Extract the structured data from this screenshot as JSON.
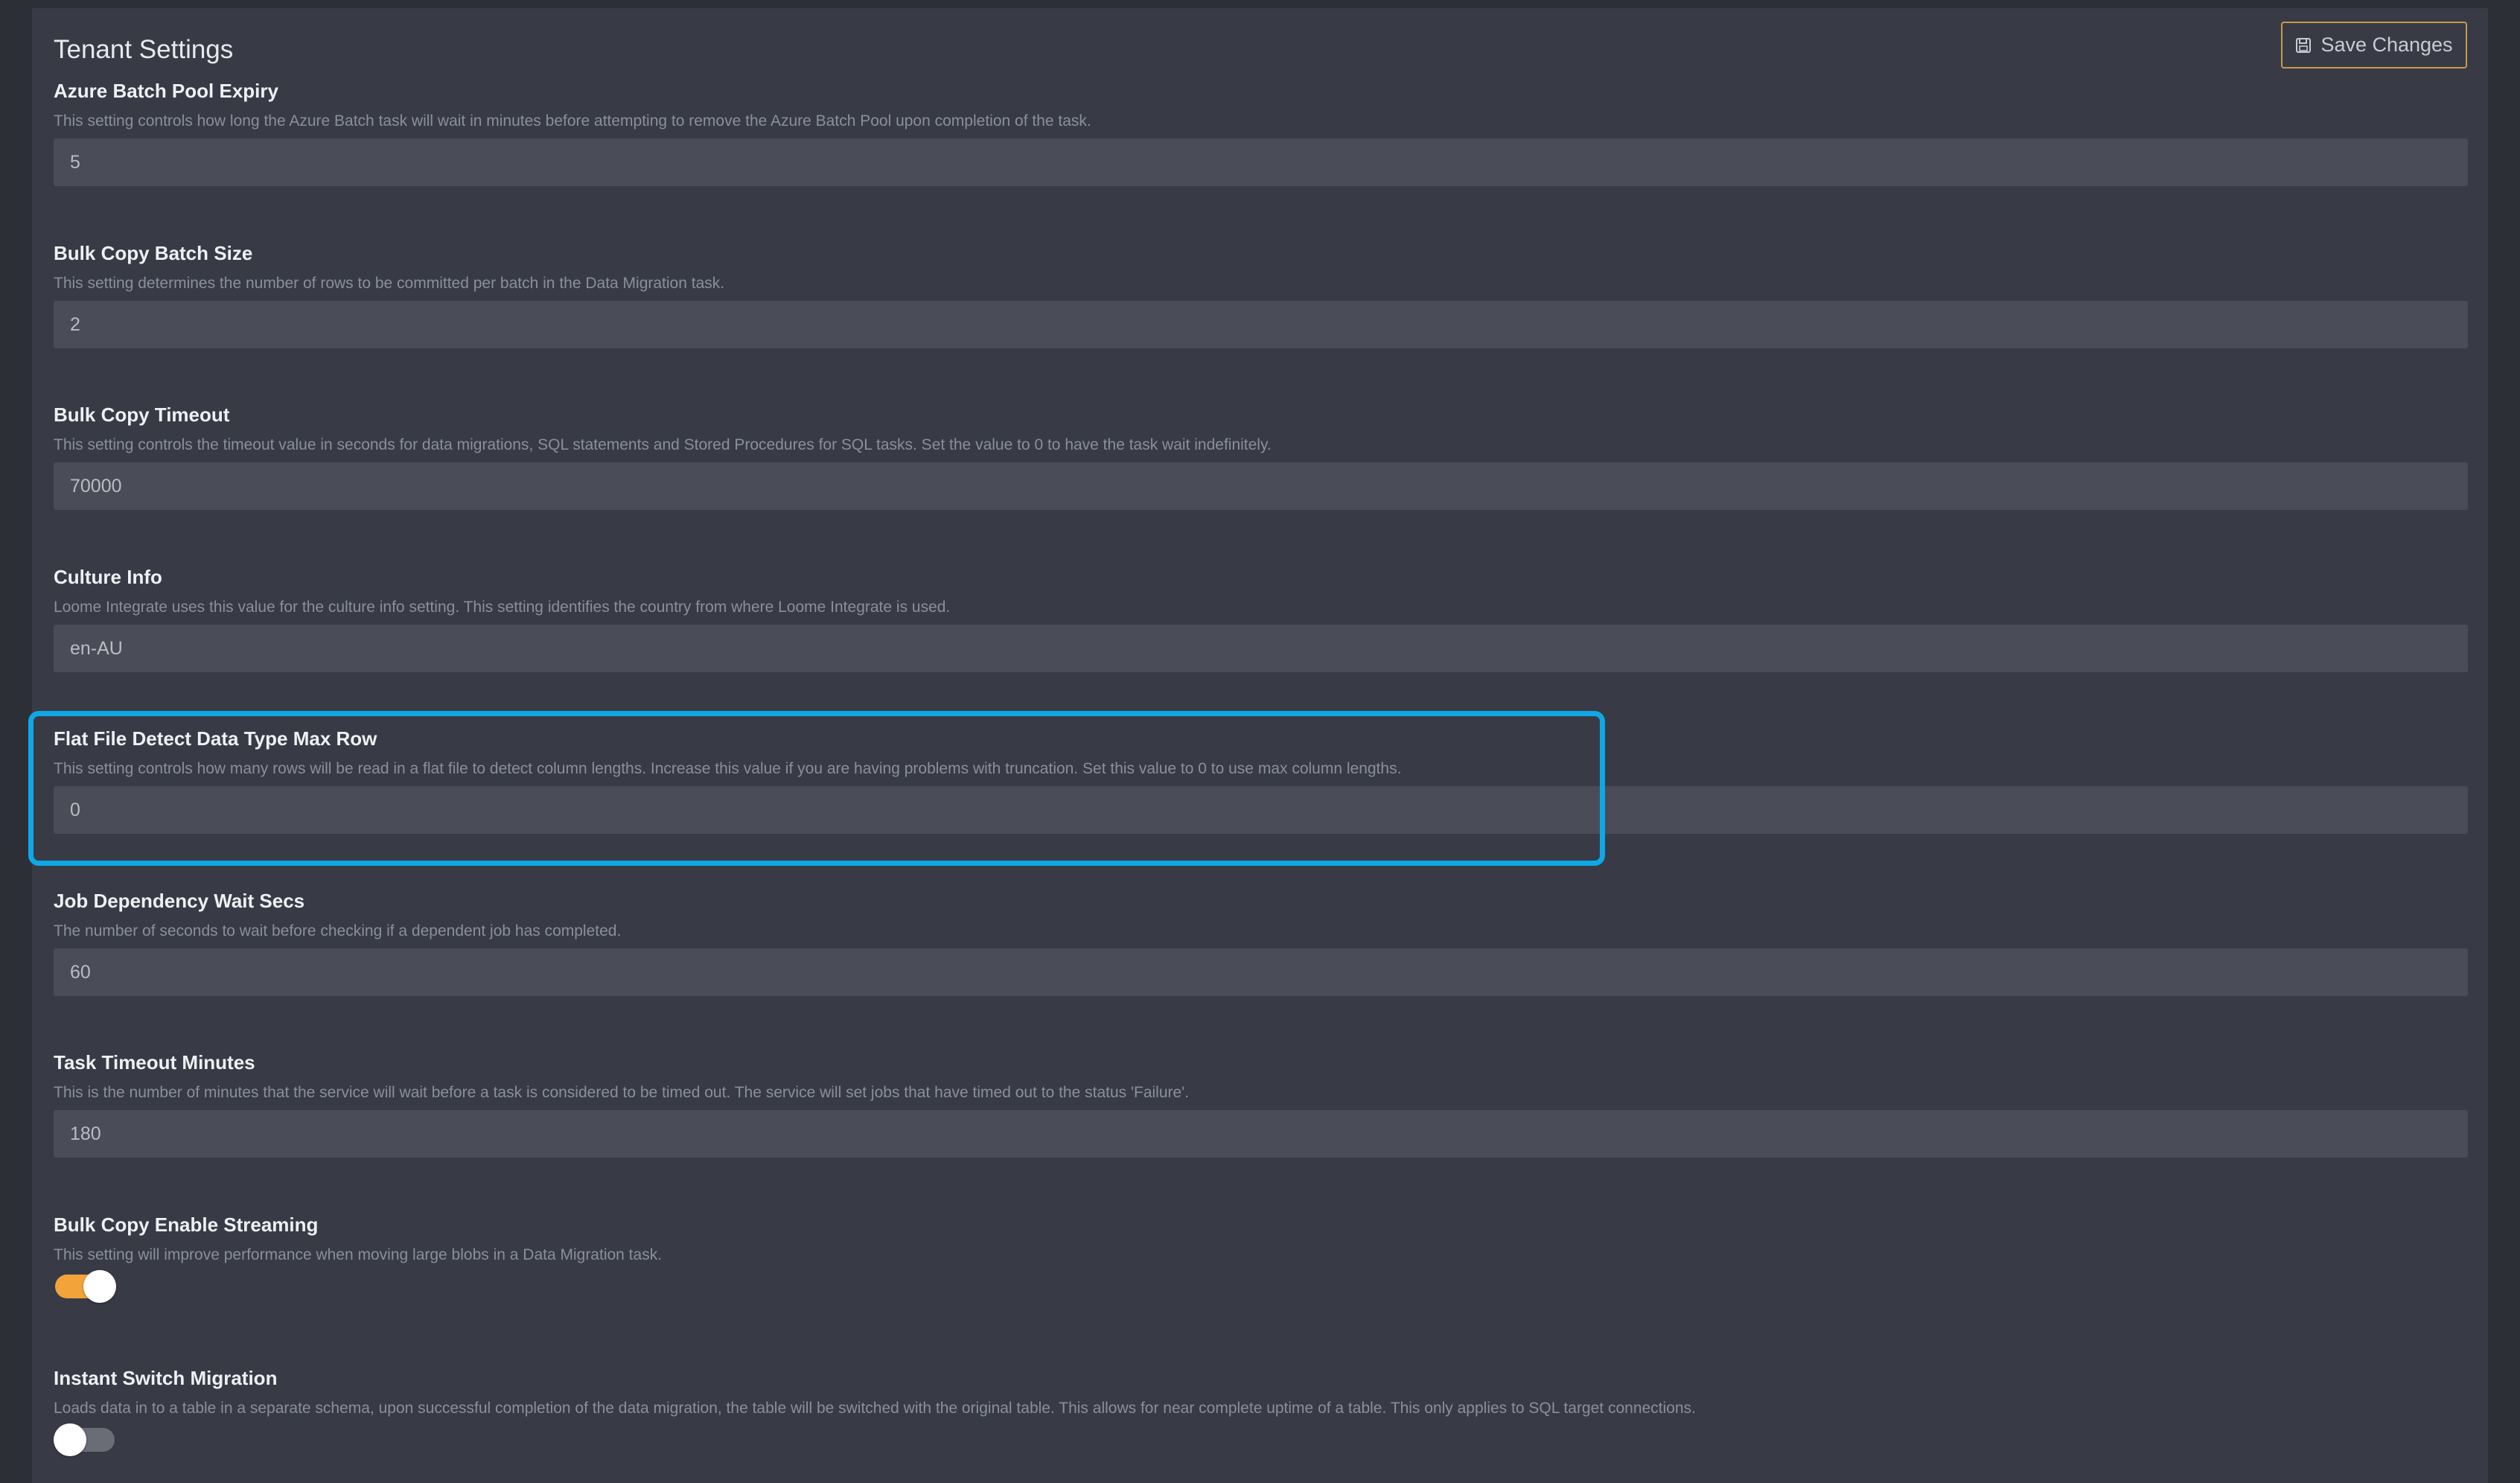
{
  "header": {
    "title": "Tenant Settings",
    "save_label": "Save Changes",
    "save_icon": "save-icon"
  },
  "settings": [
    {
      "label": "Azure Batch Pool Expiry",
      "description": "This setting controls how long the Azure Batch task will wait in minutes before attempting to remove the Azure Batch Pool upon completion of the task.",
      "value": "5"
    },
    {
      "label": "Bulk Copy Batch Size",
      "description": "This setting determines the number of rows to be committed per batch in the Data Migration task.",
      "value": "2"
    },
    {
      "label": "Bulk Copy Timeout",
      "description": "This setting controls the timeout value in seconds for data migrations, SQL statements and Stored Procedures for SQL tasks. Set the value to 0 to have the task wait indefinitely.",
      "value": "70000"
    },
    {
      "label": "Culture Info",
      "description": "Loome Integrate uses this value for the culture info setting. This setting identifies the country from where Loome Integrate is used.",
      "value": "en-AU"
    },
    {
      "label": "Flat File Detect Data Type Max Row",
      "description": "This setting controls how many rows will be read in a flat file to detect column lengths. Increase this value if you are having problems with truncation. Set this value to 0 to use max column lengths.",
      "value": "0"
    },
    {
      "label": "Job Dependency Wait Secs",
      "description": "The number of seconds to wait before checking if a dependent job has completed.",
      "value": "60"
    },
    {
      "label": "Task Timeout Minutes",
      "description": "This is the number of minutes that the service will wait before a task is considered to be timed out. The service will set jobs that have timed out to the status 'Failure'.",
      "value": "180"
    }
  ],
  "toggles": [
    {
      "label": "Bulk Copy Enable Streaming",
      "description": "This setting will improve performance when moving large blobs in a Data Migration task.",
      "enabled": true
    },
    {
      "label": "Instant Switch Migration",
      "description": "Loads data in to a table in a separate schema, upon successful completion of the data migration, the table will be switched with the original table. This allows for near complete uptime of a table. This only applies to SQL target connections.",
      "enabled": false
    }
  ],
  "colors": {
    "page_bg": "#2c2f36",
    "panel_bg": "#383b45",
    "input_bg": "#4a4d57",
    "accent": "#f2a33a",
    "save_border": "#c99a4a",
    "highlight": "#0ea8e6"
  }
}
